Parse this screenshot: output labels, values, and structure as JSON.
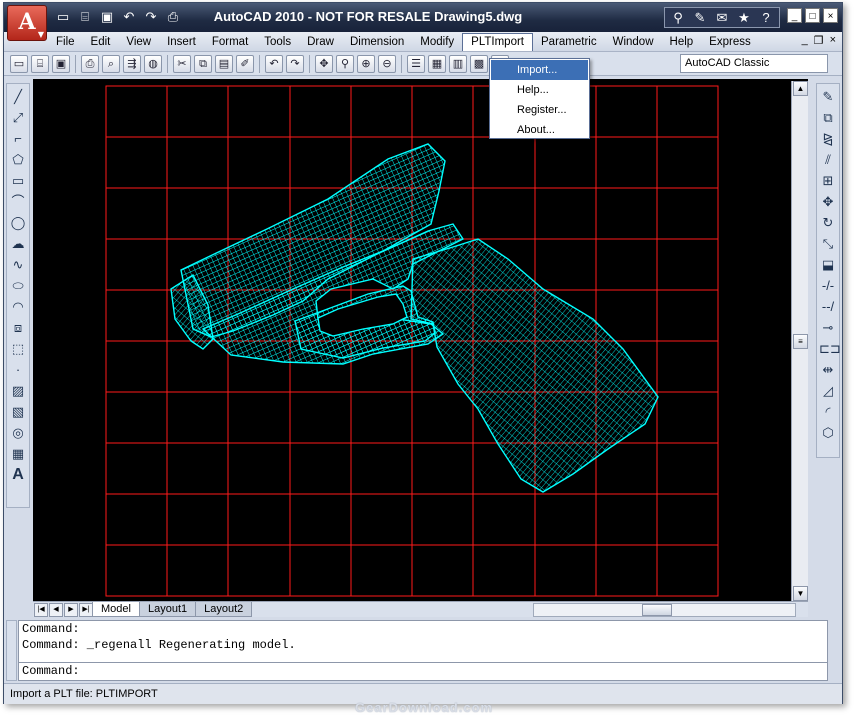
{
  "window": {
    "title": "AutoCAD 2010 - NOT FOR RESALE    Drawing5.dwg",
    "app_button_letter": "A",
    "quick_access": [
      "new-icon",
      "open-icon",
      "save-icon",
      "undo-icon",
      "redo-icon",
      "plot-icon"
    ],
    "infocenter": [
      "binoculars-icon",
      "search-tool-icon",
      "communication-icon",
      "favorites-icon",
      "help-icon"
    ],
    "controls": {
      "minimize": "_",
      "maximize": "□",
      "close": "×"
    }
  },
  "menubar": {
    "items": [
      "File",
      "Edit",
      "View",
      "Insert",
      "Format",
      "Tools",
      "Draw",
      "Dimension",
      "Modify",
      "PLTImport",
      "Parametric",
      "Window",
      "Help",
      "Express"
    ],
    "active": "PLTImport",
    "mdi_controls": {
      "minimize": "_",
      "restore": "❐",
      "close": "×"
    }
  },
  "toolbar": {
    "icons": [
      "new",
      "open",
      "save",
      "plot",
      "preview",
      "publish",
      "3d-print",
      "cut",
      "copy",
      "paste",
      "matchprop",
      "undo",
      "redo",
      "pan",
      "zoom",
      "zoom-window",
      "zoom-prev",
      "properties",
      "designcenter",
      "toolpalettes",
      "calc",
      "help"
    ],
    "workspace_value": "AutoCAD Classic"
  },
  "plt_menu": {
    "items": [
      "Import...",
      "Help...",
      "Register...",
      "About..."
    ],
    "highlighted": "Import..."
  },
  "draw_toolbar": [
    "line",
    "construction-line",
    "polyline",
    "polygon",
    "rectangle",
    "arc",
    "circle",
    "revision-cloud",
    "spline",
    "ellipse",
    "ellipse-arc",
    "insert-block",
    "make-block",
    "point",
    "hatch",
    "gradient",
    "region",
    "table",
    "multiline-text"
  ],
  "modify_toolbar": [
    "erase",
    "copy",
    "mirror",
    "offset",
    "array",
    "move",
    "rotate",
    "scale",
    "stretch",
    "trim",
    "extend",
    "break-at-point",
    "break",
    "join",
    "chamfer",
    "fillet",
    "explode"
  ],
  "layout_tabs": [
    "Model",
    "Layout1",
    "Layout2"
  ],
  "active_tab": "Model",
  "command": {
    "history": [
      "Command:",
      "Command: _regenall Regenerating model."
    ],
    "prompt": "Command:"
  },
  "status": "Import a PLT file: PLTIMPORT",
  "watermark": "GearDownload.com",
  "colors": {
    "grid": "#ff1a1a",
    "mesh": "#00ffff",
    "background": "#000000",
    "highlight": "#3c6fb5"
  }
}
